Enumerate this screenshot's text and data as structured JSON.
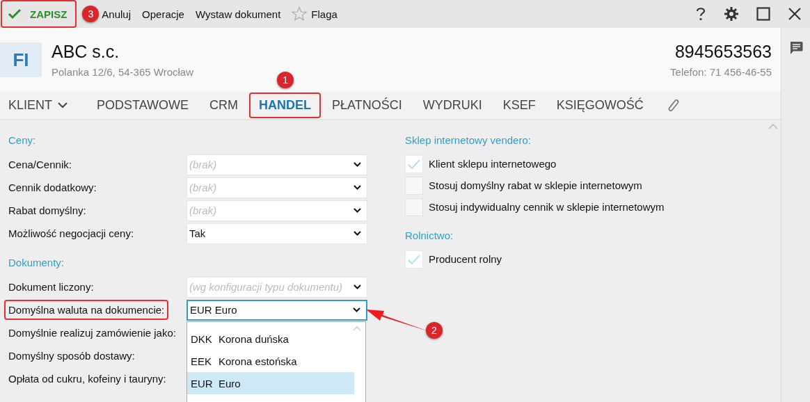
{
  "toolbar": {
    "actions": [
      {
        "kind": "save",
        "label": "ZAPISZ",
        "highlighted": true,
        "callout": "3"
      },
      {
        "kind": "plain",
        "label": "Anuluj"
      },
      {
        "kind": "plain",
        "label": "Operacje"
      },
      {
        "kind": "plain",
        "label": "Wystaw dokument"
      },
      {
        "kind": "flag",
        "label": "Flaga"
      }
    ]
  },
  "header": {
    "badge": "FI",
    "name": "ABC s.c.",
    "address": "Polanka 12/6, 54-365 Wrocław",
    "tax_id": "8945653563",
    "phone": "Telefon: 71 456-46-55"
  },
  "tabs": [
    {
      "label": "KLIENT",
      "kind": "menu",
      "selected": false
    },
    {
      "label": "PODSTAWOWE",
      "kind": "tab",
      "selected": false
    },
    {
      "label": "CRM",
      "kind": "tab",
      "selected": false
    },
    {
      "label": "HANDEL",
      "kind": "tab",
      "selected": true,
      "highlighted": true,
      "callout": "1"
    },
    {
      "label": "PŁATNOŚCI",
      "kind": "tab",
      "selected": false
    },
    {
      "label": "WYDRUKI",
      "kind": "tab",
      "selected": false
    },
    {
      "label": "KSEF",
      "kind": "tab",
      "selected": false
    },
    {
      "label": "KSIĘGOWOŚĆ",
      "kind": "tab",
      "selected": false
    }
  ],
  "left_sections": [
    {
      "title": "Ceny:",
      "fields": [
        {
          "label": "Cena/Cennik:",
          "placeholder": "(brak)",
          "highlighted": false
        },
        {
          "label": "Cennik dodatkowy:",
          "placeholder": "(brak)",
          "highlighted": false
        },
        {
          "label": "Rabat domyślny:",
          "placeholder": "(brak)",
          "highlighted": false
        },
        {
          "label": "Możliwość negocjacji ceny:",
          "value": "Tak",
          "highlighted": false
        }
      ]
    },
    {
      "title": "Dokumenty:",
      "fields": [
        {
          "label": "Dokument liczony:",
          "placeholder": "(wg konfiguracji typu dokumentu)",
          "highlighted": false
        },
        {
          "label": "Domyślna waluta na dokumencie:",
          "value": "EUR Euro",
          "highlighted": true,
          "callout": "2",
          "options": [
            {
              "code": "DKK",
              "name": "Korona duńska",
              "selected": false
            },
            {
              "code": "EEK",
              "name": "Korona estońska",
              "selected": false
            },
            {
              "code": "EUR",
              "name": "Euro",
              "selected": true
            }
          ]
        },
        {
          "label": "Domyślnie realizuj zamówienie jako:",
          "highlighted": false
        },
        {
          "label": "Domyślny sposób dostawy:",
          "highlighted": false
        },
        {
          "label": "Opłata od cukru, kofeiny i tauryny:",
          "highlighted": false
        }
      ]
    }
  ],
  "right_sections": [
    {
      "title": "Sklep internetowy vendero:",
      "options": [
        {
          "label": "Klient sklepu internetowego",
          "checked": true
        },
        {
          "label": "Stosuj domyślny rabat w sklepie internetowym",
          "checked": false
        },
        {
          "label": "Stosuj indywidualny cennik w sklepie internetowym",
          "checked": false
        }
      ]
    },
    {
      "title": "Rolnictwo:",
      "options": [
        {
          "label": "Producent rolny",
          "checked": true
        }
      ]
    }
  ]
}
